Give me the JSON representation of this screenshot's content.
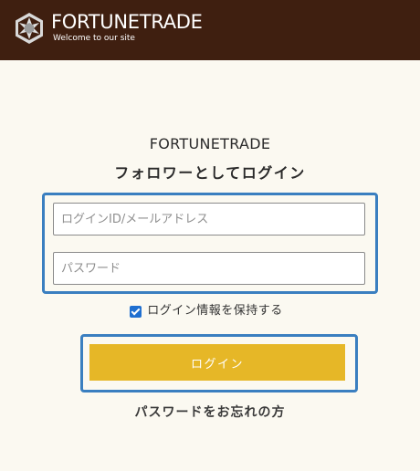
{
  "header": {
    "logo_name": "FORTUNETRADE",
    "logo_tagline": "Welcome to our site",
    "background_color": "#3f1f10",
    "logo_icon": "hexagon-star-icon"
  },
  "login": {
    "site_name": "FORTUNETRADE",
    "title": "フォロワーとしてログイン",
    "id_placeholder": "ログインID/メールアドレス",
    "id_value": "",
    "password_placeholder": "パスワード",
    "password_value": "",
    "remember_label": "ログイン情報を保持する",
    "remember_checked": true,
    "submit_label": "ログイン",
    "forgot_label": "パスワードをお忘れの方"
  },
  "colors": {
    "page_background": "#fbf9f1",
    "button": "#e6b727",
    "highlight": "#3a7fc0"
  }
}
